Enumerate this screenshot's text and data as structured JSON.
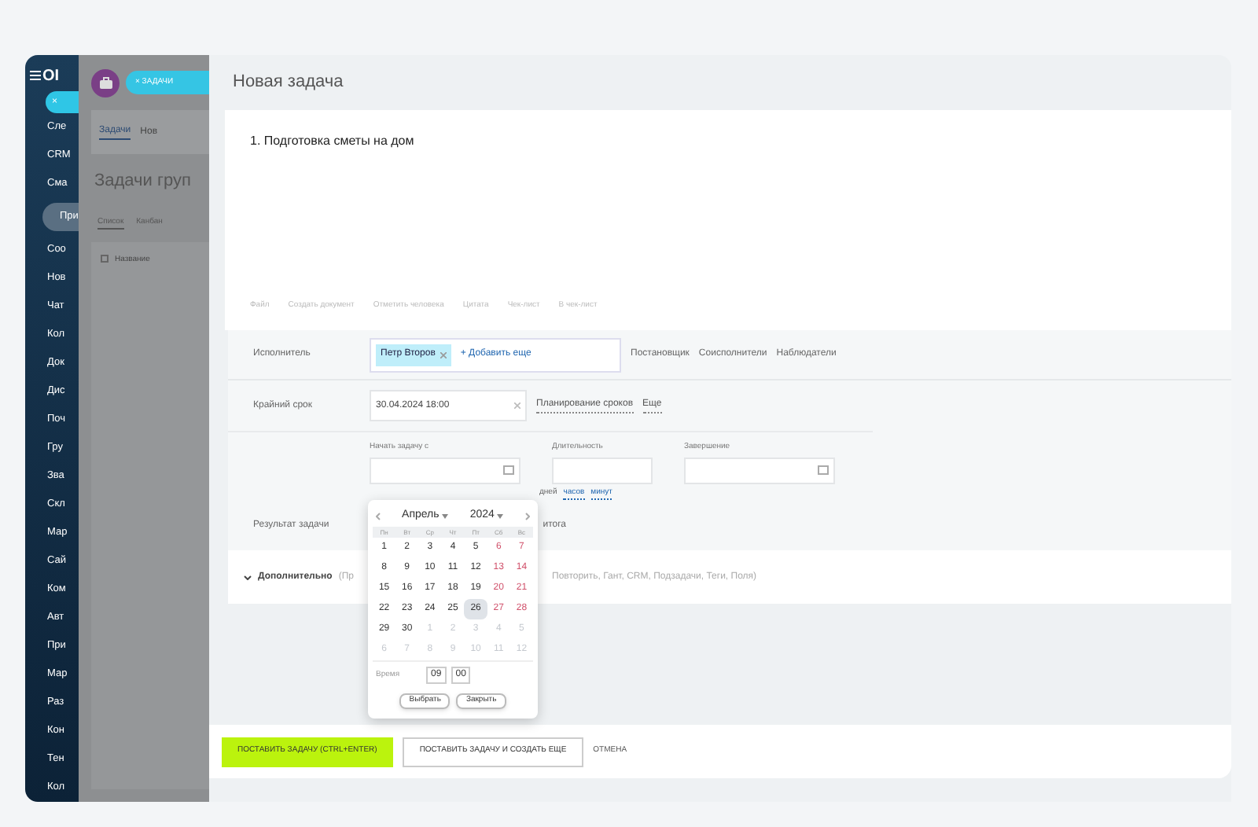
{
  "sidebar": {
    "logo": "OI",
    "close_label": "×",
    "items": [
      {
        "label": "Сле",
        "selected": false
      },
      {
        "label": "CRM",
        "selected": false
      },
      {
        "label": "Сма",
        "selected": false
      },
      {
        "label": "При",
        "selected": true
      },
      {
        "label": "Соо",
        "selected": false
      },
      {
        "label": "Нов",
        "selected": false
      },
      {
        "label": "Чат",
        "selected": false
      },
      {
        "label": "Кол",
        "selected": false
      },
      {
        "label": "Док",
        "selected": false
      },
      {
        "label": "Дис",
        "selected": false
      },
      {
        "label": "Поч",
        "selected": false
      },
      {
        "label": "Гру",
        "selected": false
      },
      {
        "label": "Зва",
        "selected": false
      },
      {
        "label": "Скл",
        "selected": false
      },
      {
        "label": "Мар",
        "selected": false
      },
      {
        "label": "Сай",
        "selected": false
      },
      {
        "label": "Ком",
        "selected": false
      },
      {
        "label": "Авт",
        "selected": false
      },
      {
        "label": "При",
        "selected": false
      },
      {
        "label": "Мар",
        "selected": false
      },
      {
        "label": "Раз",
        "selected": false
      },
      {
        "label": "Кон",
        "selected": false
      },
      {
        "label": "Тен",
        "selected": false
      },
      {
        "label": "Кол",
        "selected": false
      }
    ]
  },
  "background_page": {
    "chip": "× ЗАДАЧИ",
    "tabs": [
      {
        "label": "Задачи",
        "selected": true
      },
      {
        "label": "Нов",
        "selected": false
      }
    ],
    "title": "Задачи груп",
    "views": [
      {
        "label": "Список",
        "selected": true
      },
      {
        "label": "Канбан",
        "selected": false
      }
    ],
    "column": "Название",
    "select_all_checked": false
  },
  "panel": {
    "title": "Новая задача",
    "task_text": "1. Подготовка сметы на дом",
    "toolbar": [
      "Файл",
      "Создать документ",
      "Отметить человека",
      "Цитата",
      "Чек-лист",
      "В чек-лист"
    ],
    "assignee": {
      "label": "Исполнитель",
      "tag": "Петр Второв",
      "add": "+ Добавить еще",
      "links": [
        "Постановщик",
        "Соисполнители",
        "Наблюдатели"
      ]
    },
    "deadline": {
      "label": "Крайний срок",
      "value": "30.04.2024 18:00",
      "links": [
        "Планирование сроков",
        "Еще"
      ]
    },
    "planning": {
      "fields": [
        "Начать задачу с",
        "Длительность",
        "Завершение"
      ],
      "units": [
        "дней",
        "часов",
        "минут"
      ]
    },
    "result": {
      "label": "Результат задачи",
      "text": "итога"
    },
    "more": {
      "label": "Дополнительно",
      "before": "(Пр",
      "after": "Повторить, Гант, CRM, Подзадачи, Теги, Поля)"
    },
    "calendar": {
      "month": "Апрель",
      "year": "2024",
      "weekdays": [
        "Пн",
        "Вт",
        "Ср",
        "Чт",
        "Пт",
        "Сб",
        "Вс"
      ],
      "days": [
        {
          "label": "1",
          "kind": "day",
          "selected": false
        },
        {
          "label": "2",
          "kind": "day",
          "selected": false
        },
        {
          "label": "3",
          "kind": "day",
          "selected": false
        },
        {
          "label": "4",
          "kind": "day",
          "selected": false
        },
        {
          "label": "5",
          "kind": "day",
          "selected": false
        },
        {
          "label": "6",
          "kind": "weekend",
          "selected": false
        },
        {
          "label": "7",
          "kind": "weekend",
          "selected": false
        },
        {
          "label": "8",
          "kind": "day",
          "selected": false
        },
        {
          "label": "9",
          "kind": "day",
          "selected": false
        },
        {
          "label": "10",
          "kind": "day",
          "selected": false
        },
        {
          "label": "11",
          "kind": "day",
          "selected": false
        },
        {
          "label": "12",
          "kind": "day",
          "selected": false
        },
        {
          "label": "13",
          "kind": "weekend",
          "selected": false
        },
        {
          "label": "14",
          "kind": "weekend",
          "selected": false
        },
        {
          "label": "15",
          "kind": "day",
          "selected": false
        },
        {
          "label": "16",
          "kind": "day",
          "selected": false
        },
        {
          "label": "17",
          "kind": "day",
          "selected": false
        },
        {
          "label": "18",
          "kind": "day",
          "selected": false
        },
        {
          "label": "19",
          "kind": "day",
          "selected": false
        },
        {
          "label": "20",
          "kind": "weekend",
          "selected": false
        },
        {
          "label": "21",
          "kind": "weekend",
          "selected": false
        },
        {
          "label": "22",
          "kind": "day",
          "selected": false
        },
        {
          "label": "23",
          "kind": "day",
          "selected": false
        },
        {
          "label": "24",
          "kind": "day",
          "selected": false
        },
        {
          "label": "25",
          "kind": "day",
          "selected": false
        },
        {
          "label": "26",
          "kind": "day",
          "selected": true
        },
        {
          "label": "27",
          "kind": "weekend",
          "selected": false
        },
        {
          "label": "28",
          "kind": "weekend",
          "selected": false
        },
        {
          "label": "29",
          "kind": "day",
          "selected": false
        },
        {
          "label": "30",
          "kind": "day",
          "selected": false
        },
        {
          "label": "1",
          "kind": "other",
          "selected": false
        },
        {
          "label": "2",
          "kind": "other",
          "selected": false
        },
        {
          "label": "3",
          "kind": "other",
          "selected": false
        },
        {
          "label": "4",
          "kind": "other",
          "selected": false
        },
        {
          "label": "5",
          "kind": "other",
          "selected": false
        },
        {
          "label": "6",
          "kind": "other",
          "selected": false
        },
        {
          "label": "7",
          "kind": "other",
          "selected": false
        },
        {
          "label": "8",
          "kind": "other",
          "selected": false
        },
        {
          "label": "9",
          "kind": "other",
          "selected": false
        },
        {
          "label": "10",
          "kind": "other",
          "selected": false
        },
        {
          "label": "11",
          "kind": "other",
          "selected": false
        },
        {
          "label": "12",
          "kind": "other",
          "selected": false
        }
      ],
      "time_label": "Время",
      "hours": "09",
      "minutes": "00",
      "buttons": [
        "Выбрать",
        "Закрыть"
      ]
    },
    "footer": {
      "primary": "ПОСТАВИТЬ ЗАДАЧУ (CTRL+ENTER)",
      "secondary": "ПОСТАВИТЬ ЗАДАЧУ И СОЗДАТЬ ЕЩЕ",
      "cancel": "ОТМЕНА"
    }
  }
}
